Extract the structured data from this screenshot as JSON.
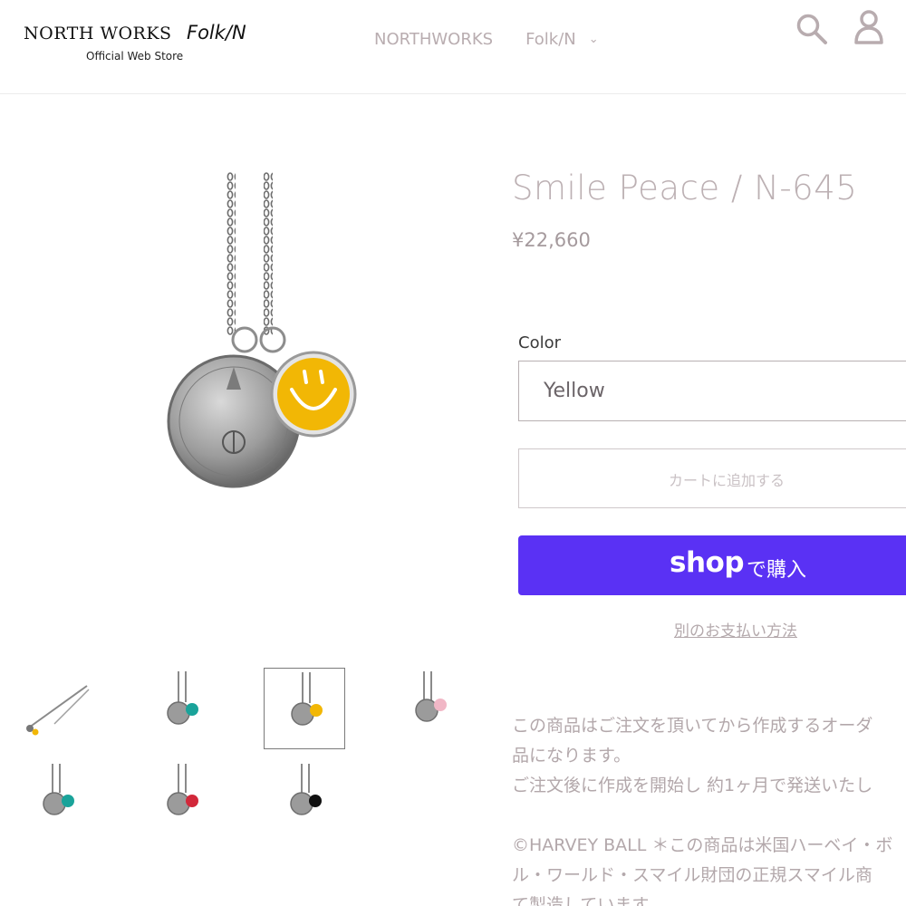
{
  "header": {
    "logo": {
      "brand_primary": "NORTH WORKS",
      "brand_secondary": "Folk/N",
      "tagline": "Official Web Store"
    },
    "nav": [
      {
        "label": "NORTHWORKS",
        "has_dropdown": false
      },
      {
        "label": "Folk/N",
        "has_dropdown": true,
        "dropdown_icon": "chevron-down-icon"
      }
    ],
    "icons": [
      "search-icon",
      "user-icon"
    ]
  },
  "product": {
    "title": "Smile Peace / N-645",
    "price": "¥22,660",
    "color_label": "Color",
    "color_selected": "Yellow",
    "add_to_cart_label": "カートに追加する",
    "shop_pay": {
      "logo_text": "shop",
      "label": "で購入"
    },
    "alt_payment_label": "別のお支払い方法",
    "description_lines": [
      "この商品はご注文を頂いてから作成するオーダ",
      "品になります。",
      "ご注文後に作成を開始し 約1ヶ月で発送いたし",
      "",
      "©HARVEY BALL ＊この商品は米国ハーベイ・ボ",
      "ル・ワールド・スマイル財団の正規スマイル商",
      "て製造しています。"
    ]
  },
  "gallery": {
    "selected_index": 2,
    "thumbnails": [
      {
        "variant": "side-view",
        "accent": "#f2b705"
      },
      {
        "variant": "turquoise",
        "accent": "#1aa39a"
      },
      {
        "variant": "yellow",
        "accent": "#f2b705"
      },
      {
        "variant": "pink",
        "accent": "#f1b7c6"
      },
      {
        "variant": "turquoise-2",
        "accent": "#1aa39a"
      },
      {
        "variant": "red",
        "accent": "#d2283a"
      },
      {
        "variant": "black",
        "accent": "#111111"
      }
    ]
  },
  "colors": {
    "shop_pay": "#5a31f4",
    "title": "#bcb0b3",
    "nav": "#b9adb0",
    "charm_yellow": "#f2b705"
  }
}
